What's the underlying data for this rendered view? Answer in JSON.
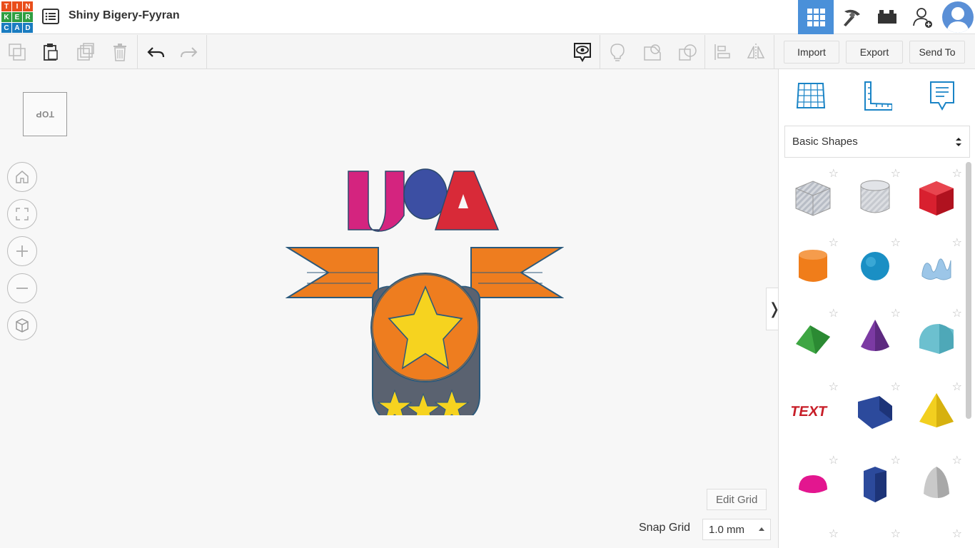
{
  "app": {
    "logo_letters": [
      "T",
      "I",
      "N",
      "K",
      "E",
      "R",
      "C",
      "A",
      "D"
    ],
    "logo_colors": [
      "#e94e1b",
      "#e94e1b",
      "#e94e1b",
      "#2f9e41",
      "#2f9e41",
      "#2f9e41",
      "#1a7cc0",
      "#1a7cc0",
      "#1a7cc0"
    ],
    "design_title": "Shiny Bigery-Fyyran",
    "accent_color": "#4a90d9"
  },
  "toolbar": {
    "import_label": "Import",
    "export_label": "Export",
    "send_to_label": "Send To"
  },
  "viewcube": {
    "face_label": "TOP"
  },
  "workplane": {
    "edit_grid_label": "Edit Grid",
    "snap_grid_label": "Snap Grid",
    "snap_grid_value": "1.0 mm",
    "collapse_glyph": "❭",
    "model_text": "USA"
  },
  "panel": {
    "library_selected": "Basic Shapes",
    "shapes": [
      {
        "name": "box-hole",
        "color": "#b8bdc6"
      },
      {
        "name": "cylinder-hole",
        "color": "#c6c9cf"
      },
      {
        "name": "box",
        "color": "#d8202f"
      },
      {
        "name": "cylinder",
        "color": "#f07d1a"
      },
      {
        "name": "sphere",
        "color": "#1a8fc4"
      },
      {
        "name": "scribble",
        "color": "#9cc6e8"
      },
      {
        "name": "roof",
        "color": "#3ea643"
      },
      {
        "name": "cone",
        "color": "#7b3aa3"
      },
      {
        "name": "round-roof",
        "color": "#6cc0cf"
      },
      {
        "name": "text",
        "color": "#c81e28"
      },
      {
        "name": "wedge",
        "color": "#2c4a9c"
      },
      {
        "name": "pyramid",
        "color": "#f2cf1f"
      },
      {
        "name": "half-sphere",
        "color": "#e3168f"
      },
      {
        "name": "polygon",
        "color": "#2c4a9c"
      },
      {
        "name": "paraboloid",
        "color": "#c9c9c9"
      }
    ]
  }
}
